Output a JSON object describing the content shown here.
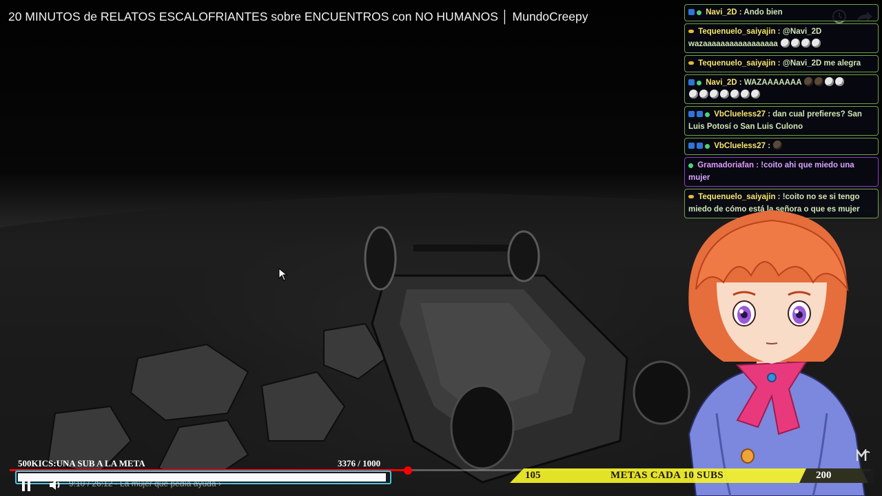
{
  "video": {
    "title": "20 MINUTOS de RELATOS ESCALOFRIANTES sobre ENCUENTROS con NO HUMANOS │ MundoCreepy",
    "timecode": "9:10 / 26:12 · La mujer que pedía ayuda ›",
    "progress_fraction": 0.462
  },
  "chat": {
    "messages": [
      {
        "user": "Navi_2D",
        "text": " : Ando bien",
        "style": "green"
      },
      {
        "user": "Tequenuelo_saiyajin",
        "text": " : @Navi_2D wazaaaaaaaaaaaaaaaaa",
        "style": "green"
      },
      {
        "user": "Tequenuelo_saiyajin",
        "text": " : @Navi_2D me alegra",
        "style": "green"
      },
      {
        "user": "Navi_2D",
        "text": " : WAZAAAAAAA",
        "style": "green"
      },
      {
        "user": "VbClueless27",
        "text": " : dan cual prefieres? San Luis Potosí o San Luis Culono",
        "style": "green"
      },
      {
        "user": "VbClueless27",
        "text": " :",
        "style": "green"
      },
      {
        "user": "Gramadoriafan",
        "text": " : !coito ahi que miedo una mujer",
        "style": "purple"
      },
      {
        "user": "Tequenuelo_saiyajin",
        "text": " : !coito no se si tengo miedo de cómo está la señora o que es mujer",
        "style": "green"
      }
    ]
  },
  "goal_left": {
    "label": "500KICS:UNA SUB A LA META",
    "count": "3376  / 1000",
    "fill_fraction": 1.0
  },
  "goal_subs": {
    "start": "105",
    "text": "METAS CADA 10 SUBS",
    "end": "200"
  },
  "colors": {
    "chat_border": "#6fa34a",
    "chat_border_alt": "#8a3fd0",
    "username": "#f7e66b",
    "goal_border": "#46c7e8",
    "subs_yellow": "#f5f22a",
    "progress": "#ff0000"
  }
}
